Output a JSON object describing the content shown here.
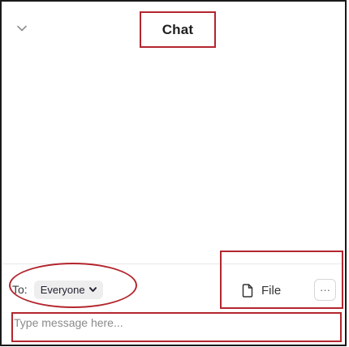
{
  "header": {
    "title": "Chat",
    "collapse_icon": "chevron-down-icon"
  },
  "recipient": {
    "label": "To:",
    "value": "Everyone",
    "dropdown_icon": "chevron-down-icon"
  },
  "actions": {
    "file_label": "File",
    "file_icon": "file-icon",
    "more_label": "···",
    "more_icon": "more-options-icon"
  },
  "composer": {
    "placeholder": "Type message here...",
    "value": ""
  },
  "colors": {
    "highlight": "#b3262e",
    "panel_border": "#1a1a1a",
    "pill_background": "#eeeeee"
  }
}
